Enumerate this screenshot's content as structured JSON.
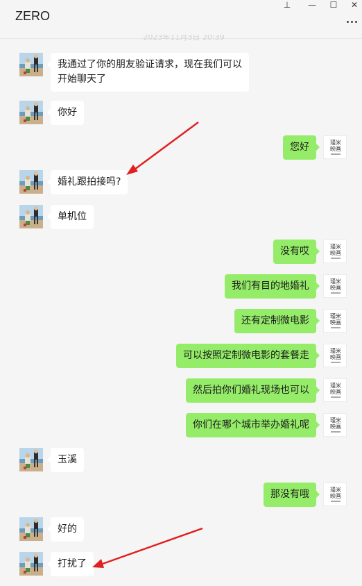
{
  "window": {
    "title": "ZERO",
    "pin_glyph": "⊥",
    "minimize_glyph": "—",
    "maximize_glyph": "☐",
    "close_glyph": "✕",
    "timestamp": "2023年11月3日 20:39"
  },
  "colors": {
    "sent_bubble": "#95ec69",
    "received_bubble": "#ffffff",
    "background": "#f5f5f5",
    "annotation_arrow": "#e02020"
  },
  "right_avatar": {
    "line1": "瑾米",
    "line2": "映画"
  },
  "messages": [
    {
      "side": "left",
      "text": "我通过了你的朋友验证请求，现在我们可以开始聊天了"
    },
    {
      "side": "left",
      "text": "你好"
    },
    {
      "side": "right",
      "text": "您好"
    },
    {
      "side": "left",
      "text": "婚礼跟拍接吗?"
    },
    {
      "side": "left",
      "text": "单机位"
    },
    {
      "side": "right",
      "text": "没有哎"
    },
    {
      "side": "right",
      "text": "我们有目的地婚礼"
    },
    {
      "side": "right",
      "text": "还有定制微电影"
    },
    {
      "side": "right",
      "text": "可以按照定制微电影的套餐走"
    },
    {
      "side": "right",
      "text": "然后拍你们婚礼现场也可以"
    },
    {
      "side": "right",
      "text": "你们在哪个城市举办婚礼呢"
    },
    {
      "side": "left",
      "text": "玉溪"
    },
    {
      "side": "right",
      "text": "那没有哦"
    },
    {
      "side": "left",
      "text": "好的"
    },
    {
      "side": "left",
      "text": "打扰了"
    }
  ]
}
